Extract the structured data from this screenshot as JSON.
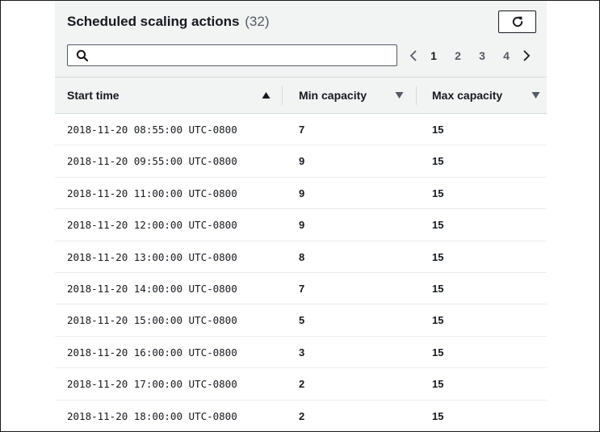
{
  "header": {
    "title": "Scheduled scaling actions",
    "count": "(32)"
  },
  "search": {
    "value": "",
    "placeholder": ""
  },
  "pagination": {
    "pages": [
      "1",
      "2",
      "3",
      "4"
    ],
    "current_page": "1"
  },
  "table": {
    "columns": [
      {
        "label": "Start time",
        "sort": "ascending"
      },
      {
        "label": "Min capacity",
        "sort": "none"
      },
      {
        "label": "Max capacity",
        "sort": "none"
      }
    ],
    "rows": [
      {
        "start_time": "2018-11-20 08:55:00 UTC-0800",
        "min_capacity": "7",
        "max_capacity": "15"
      },
      {
        "start_time": "2018-11-20 09:55:00 UTC-0800",
        "min_capacity": "9",
        "max_capacity": "15"
      },
      {
        "start_time": "2018-11-20 11:00:00 UTC-0800",
        "min_capacity": "9",
        "max_capacity": "15"
      },
      {
        "start_time": "2018-11-20 12:00:00 UTC-0800",
        "min_capacity": "9",
        "max_capacity": "15"
      },
      {
        "start_time": "2018-11-20 13:00:00 UTC-0800",
        "min_capacity": "8",
        "max_capacity": "15"
      },
      {
        "start_time": "2018-11-20 14:00:00 UTC-0800",
        "min_capacity": "7",
        "max_capacity": "15"
      },
      {
        "start_time": "2018-11-20 15:00:00 UTC-0800",
        "min_capacity": "5",
        "max_capacity": "15"
      },
      {
        "start_time": "2018-11-20 16:00:00 UTC-0800",
        "min_capacity": "3",
        "max_capacity": "15"
      },
      {
        "start_time": "2018-11-20 17:00:00 UTC-0800",
        "min_capacity": "2",
        "max_capacity": "15"
      },
      {
        "start_time": "2018-11-20 18:00:00 UTC-0800",
        "min_capacity": "2",
        "max_capacity": "15"
      }
    ]
  },
  "icons": {
    "refresh": "refresh-icon",
    "search": "search-icon",
    "prev_page": "chevron-left-icon",
    "next_page": "chevron-right-icon",
    "sort_ascending": "caret-up-icon",
    "sort_none": "caret-down-icon"
  },
  "colors": {
    "panel_background": "#f2f3f3",
    "text": "#16191f",
    "muted_text": "#545b64",
    "row_divider": "#eaeded"
  }
}
